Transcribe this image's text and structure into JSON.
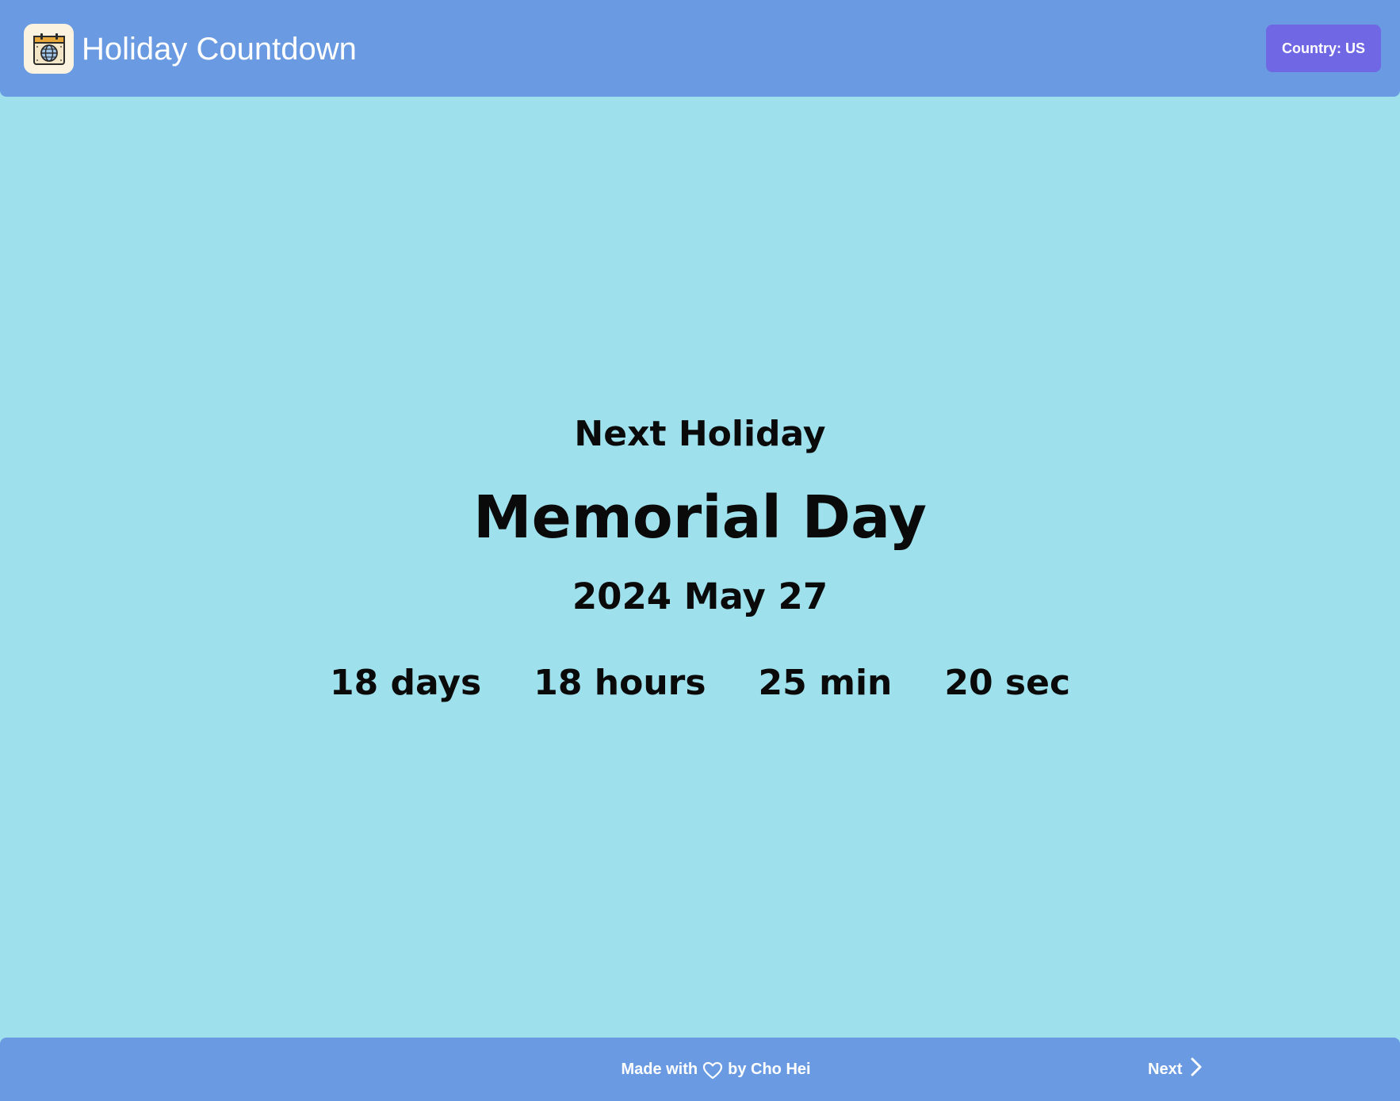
{
  "header": {
    "app_title": "Holiday Countdown",
    "logo_icon": "calendar-globe-icon",
    "country_button_label": "Country: US"
  },
  "main": {
    "label": "Next Holiday",
    "holiday_name": "Memorial Day",
    "holiday_date": "2024 May 27",
    "countdown": {
      "days": "18 days",
      "hours": "18 hours",
      "minutes": "25 min",
      "seconds": "20 sec"
    }
  },
  "footer": {
    "credit_prefix": "Made with",
    "credit_icon": "heart-icon",
    "credit_suffix": "by Cho Hei",
    "next_label": "Next",
    "next_icon": "chevron-right-icon"
  },
  "colors": {
    "background": "#9ee0ec",
    "bar": "#6a9be2",
    "accent_button": "#7067e4",
    "text": "#0a0a0a",
    "bar_text": "#ffffff"
  }
}
